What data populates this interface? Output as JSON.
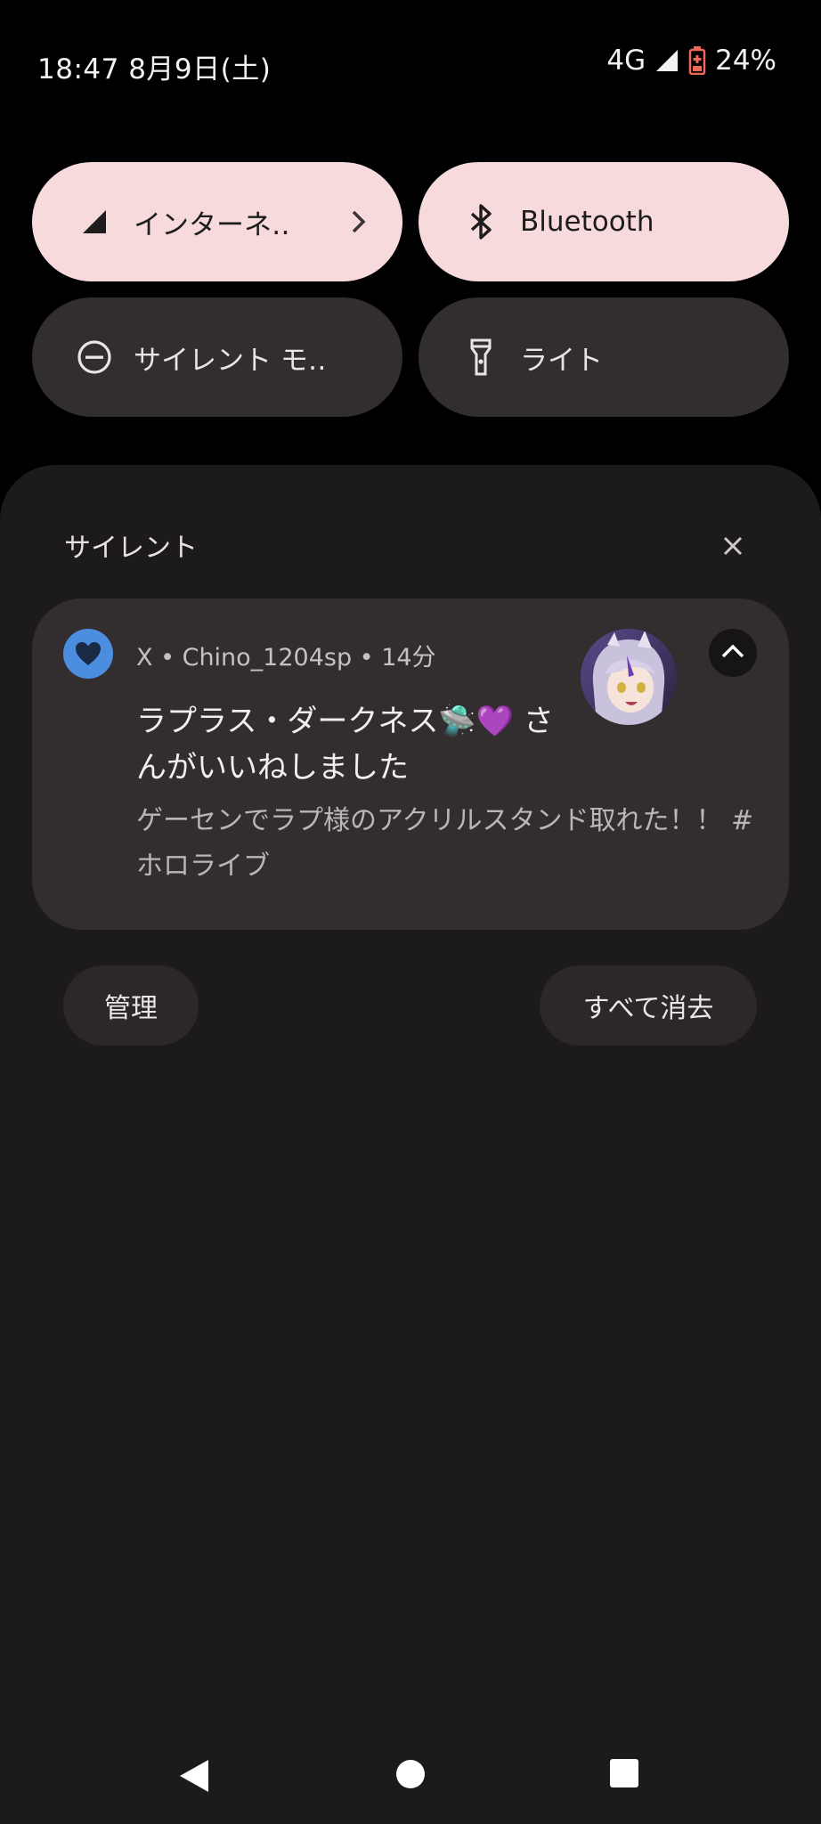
{
  "status_bar": {
    "time_date": "18:47 8月9日(土)",
    "network": "4G",
    "battery": "24%"
  },
  "quick_settings": {
    "tiles": [
      {
        "label": "インターネ‥",
        "state": "on",
        "icon": "signal-icon"
      },
      {
        "label": "Bluetooth",
        "state": "on",
        "icon": "bluetooth-icon"
      },
      {
        "label": "サイレント モ‥",
        "state": "off",
        "icon": "do-not-disturb-icon"
      },
      {
        "label": "ライト",
        "state": "off",
        "icon": "flashlight-icon"
      }
    ]
  },
  "notifications": {
    "section_title": "サイレント",
    "card": {
      "meta": "X • Chino_1204sp • 14分",
      "title": "ラプラス・ダークネス🛸💜 さんがいいねしました",
      "body": "ゲーセンでラプ様のアクリルスタンド取れた！！ #ホロライブ"
    },
    "manage_label": "管理",
    "clear_all_label": "すべて消去"
  },
  "colors": {
    "tile_on": "#f7dadc",
    "tile_off": "#322e2f",
    "shade": "#1c1a1a",
    "card": "#322e2f",
    "app_icon": "#4b8ee0"
  }
}
